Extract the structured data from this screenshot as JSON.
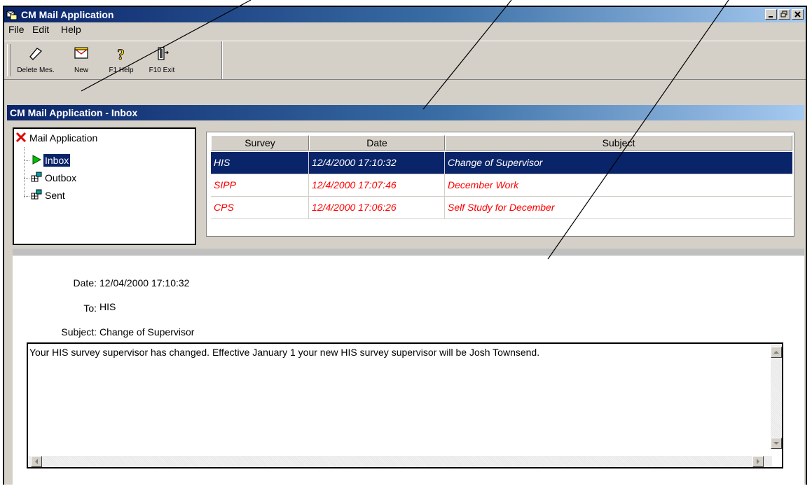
{
  "window": {
    "title": "CM Mail Application"
  },
  "menu": [
    "File",
    "Edit",
    "Help"
  ],
  "toolbar": [
    {
      "label": "Delete Mes.",
      "icon": "eraser-icon"
    },
    {
      "label": "New",
      "icon": "new-message-icon"
    },
    {
      "label": "F1 Help",
      "icon": "help-icon"
    },
    {
      "label": "F10 Exit",
      "icon": "exit-icon"
    }
  ],
  "pane_title": "CM Mail Application - Inbox",
  "tree": {
    "root": "Mail Application",
    "items": [
      "Inbox",
      "Outbox",
      "Sent"
    ],
    "selected": "Inbox"
  },
  "grid": {
    "columns": [
      "Survey",
      "Date",
      "Subject"
    ],
    "rows": [
      {
        "survey": "HIS",
        "date": "12/4/2000 17:10:32",
        "subject": "Change of Supervisor",
        "state": "selected"
      },
      {
        "survey": "SIPP",
        "date": "12/4/2000 17:07:46",
        "subject": "December Work",
        "state": "unread"
      },
      {
        "survey": "CPS",
        "date": "12/4/2000 17:06:26",
        "subject": "Self Study for December",
        "state": "unread"
      }
    ]
  },
  "message": {
    "date_label": "Date:",
    "date_value": "12/04/2000 17:10:32",
    "to_label": "To:",
    "to_value": "HIS",
    "subject_label": "Subject:",
    "subject_value": "Change of Supervisor",
    "body": "Your HIS survey supervisor has changed. Effective January 1 your new HIS survey supervisor will be Josh Townsend."
  },
  "colors": {
    "title_dark": "#0a246a",
    "unread_text": "#ff0000",
    "chrome": "#d4d0c8"
  }
}
